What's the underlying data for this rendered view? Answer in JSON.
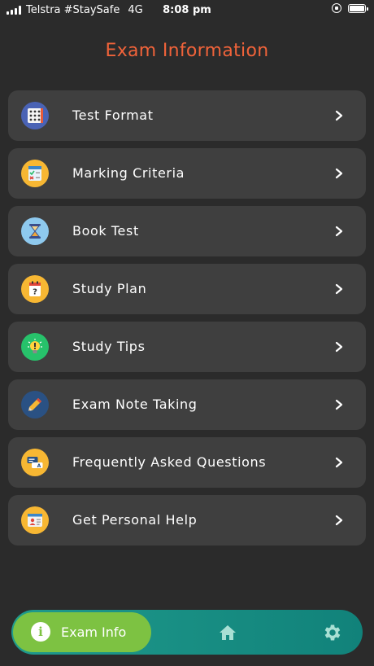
{
  "status_bar": {
    "carrier": "Telstra #StaySafe",
    "network": "4G",
    "time": "8:08 pm"
  },
  "page_title": "Exam Information",
  "menu": [
    {
      "label": "Test Format",
      "icon": "dice-grid-icon",
      "icon_bg": "#4a63b5"
    },
    {
      "label": "Marking Criteria",
      "icon": "checklist-icon",
      "icon_bg": "#f7b733"
    },
    {
      "label": "Book Test",
      "icon": "hourglass-icon",
      "icon_bg": "#8ec9ee"
    },
    {
      "label": "Study Plan",
      "icon": "calendar-question-icon",
      "icon_bg": "#f7b733"
    },
    {
      "label": "Study Tips",
      "icon": "lightbulb-icon",
      "icon_bg": "#27c26b"
    },
    {
      "label": "Exam Note Taking",
      "icon": "pencil-icon",
      "icon_bg": "#2a5183"
    },
    {
      "label": "Frequently Asked Questions",
      "icon": "chat-bubbles-icon",
      "icon_bg": "#f7b733"
    },
    {
      "label": "Get Personal Help",
      "icon": "profile-card-icon",
      "icon_bg": "#f7b733"
    }
  ],
  "bottom_nav": {
    "active_label": "Exam Info",
    "active_color": "#7dc242",
    "bar_color": "#148a7f"
  }
}
